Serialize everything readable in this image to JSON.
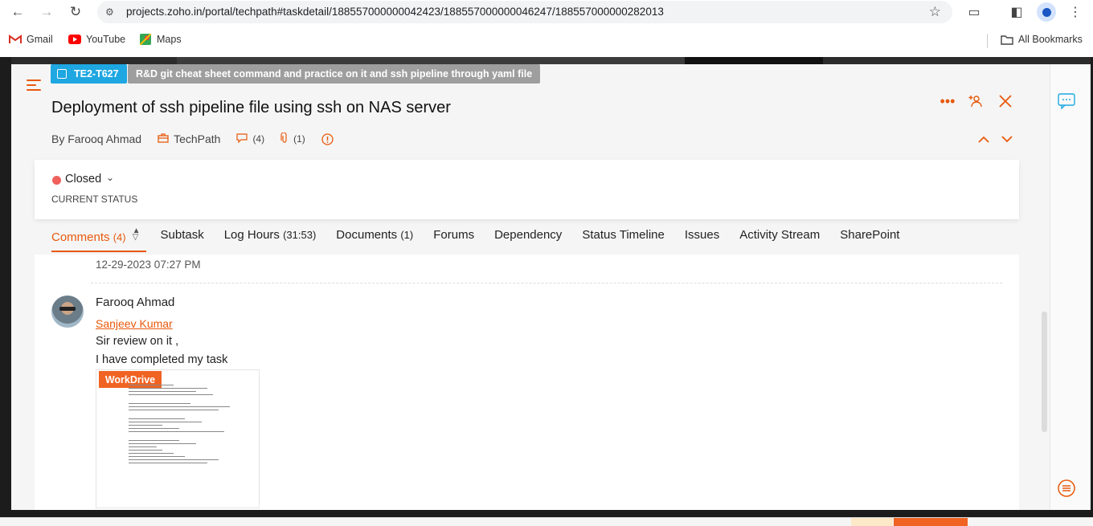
{
  "browser": {
    "url": "projects.zoho.in/portal/techpath#taskdetail/188557000000042423/188557000000046247/188557000000282013",
    "bookmarks": [
      {
        "label": "Gmail"
      },
      {
        "label": "YouTube"
      },
      {
        "label": "Maps"
      }
    ],
    "all_bookmarks": "All Bookmarks"
  },
  "task": {
    "id": "TE2-T627",
    "parent_title": "R&D git cheat sheet command and practice on it and ssh pipeline through yaml file",
    "title": "Deployment of ssh pipeline file using ssh on NAS server",
    "author": "By Farooq Ahmad",
    "project": "TechPath",
    "comment_count": "(4)",
    "attachment_count": "(1)",
    "status": "Closed",
    "status_label": "CURRENT STATUS",
    "status_color": "#f0605d"
  },
  "tabs": [
    {
      "label": "Comments",
      "count": "(4)"
    },
    {
      "label": "Subtask",
      "count": ""
    },
    {
      "label": "Log Hours",
      "count": "(31:53)"
    },
    {
      "label": "Documents",
      "count": "(1)"
    },
    {
      "label": "Forums",
      "count": ""
    },
    {
      "label": "Dependency",
      "count": ""
    },
    {
      "label": "Status Timeline",
      "count": ""
    },
    {
      "label": "Issues",
      "count": ""
    },
    {
      "label": "Activity Stream",
      "count": ""
    },
    {
      "label": "SharePoint",
      "count": ""
    }
  ],
  "comment": {
    "prev_timestamp": "12-29-2023 07:27 PM",
    "author": "Farooq Ahmad",
    "mention": "Sanjeev Kumar",
    "line1": "Sir review on it ,",
    "line2": "I have completed my task",
    "attachment_badge": "WorkDrive"
  },
  "colors": {
    "accent": "#e8590c",
    "task_id_bg": "#1ea7e1",
    "parent_bg": "#9e9e9e"
  }
}
